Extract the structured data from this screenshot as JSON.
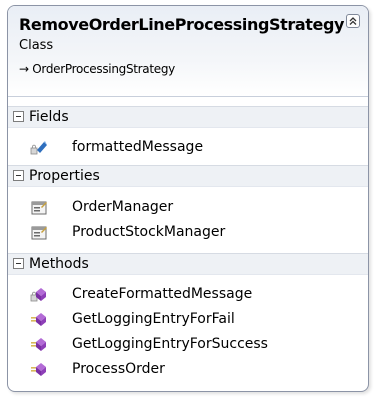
{
  "class": {
    "name": "RemoveOrderLineProcessingStrategy",
    "kind": "Class",
    "base": "→ OrderProcessingStrategy"
  },
  "sections": {
    "fields": {
      "title": "Fields",
      "items": [
        {
          "label": "formattedMessage",
          "icon": "protected-field-icon"
        }
      ]
    },
    "properties": {
      "title": "Properties",
      "items": [
        {
          "label": "OrderManager",
          "icon": "property-icon"
        },
        {
          "label": "ProductStockManager",
          "icon": "property-icon"
        }
      ]
    },
    "methods": {
      "title": "Methods",
      "items": [
        {
          "label": "CreateFormattedMessage",
          "icon": "protected-method-icon"
        },
        {
          "label": "GetLoggingEntryForFail",
          "icon": "public-method-icon"
        },
        {
          "label": "GetLoggingEntryForSuccess",
          "icon": "public-method-icon"
        },
        {
          "label": "ProcessOrder",
          "icon": "public-method-icon"
        }
      ]
    }
  },
  "colors": {
    "border": "#8c94a6",
    "method": "#8e3fb8",
    "field": "#2f6fbe"
  }
}
